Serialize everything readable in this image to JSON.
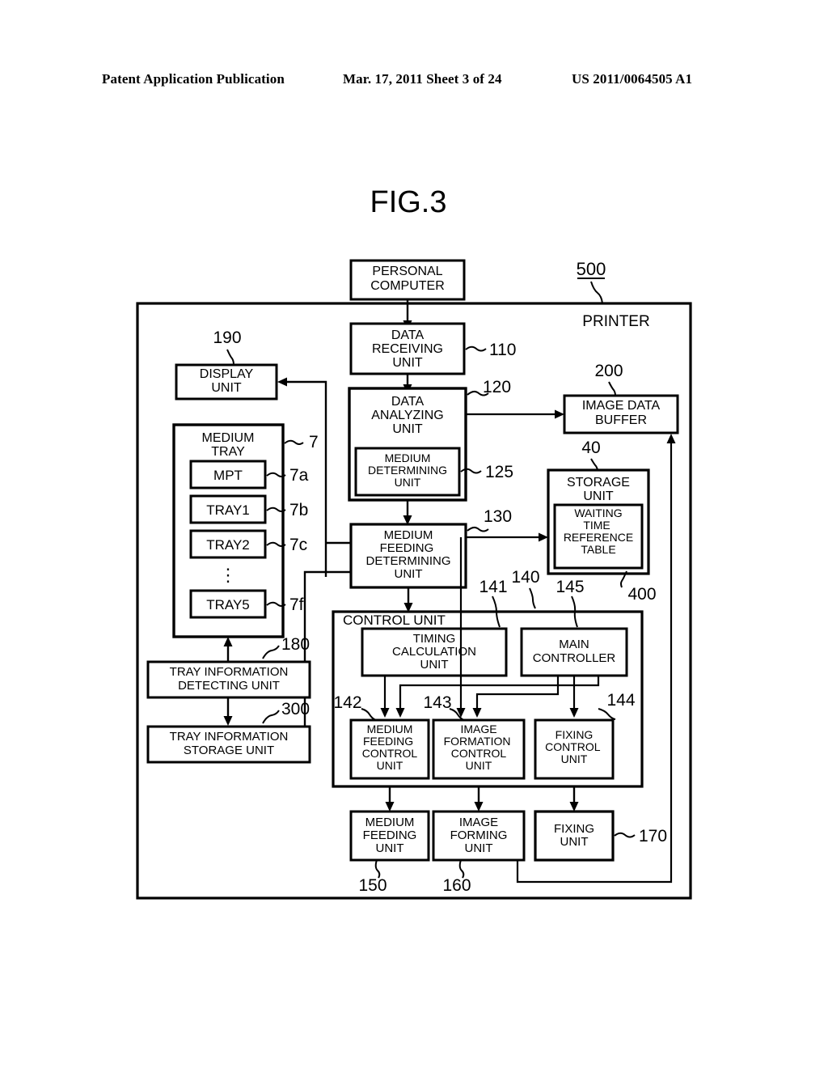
{
  "header": {
    "publication": "Patent Application Publication",
    "date_sheet": "Mar. 17, 2011  Sheet 3 of 24",
    "patent_number": "US 2011/0064505 A1"
  },
  "figure": {
    "title": "FIG.3",
    "enclosure_label": "PRINTER",
    "enclosure_ref": "500",
    "control_unit_label": "CONTROL  UNIT"
  },
  "blocks": {
    "personal_computer": {
      "label": "PERSONAL\nCOMPUTER",
      "ref": ""
    },
    "data_receiving": {
      "label": "DATA\nRECEIVING\nUNIT",
      "ref": "110"
    },
    "data_analyzing": {
      "label": "DATA\nANALYZING\nUNIT",
      "ref": "120"
    },
    "medium_determining": {
      "label": "MEDIUM\nDETERMINING\nUNIT",
      "ref": "125"
    },
    "medium_feeding_determining": {
      "label": "MEDIUM\nFEEDING\nDETERMINING\nUNIT",
      "ref": "130"
    },
    "display_unit": {
      "label": "DISPLAY\nUNIT",
      "ref": "190"
    },
    "medium_tray": {
      "label": "MEDIUM\nTRAY",
      "ref": "7"
    },
    "image_data_buffer": {
      "label": "IMAGE  DATA\nBUFFER",
      "ref": "200"
    },
    "storage_unit": {
      "label": "STORAGE\nUNIT",
      "ref": "40"
    },
    "waiting_time_reference_table": {
      "label": "WAITING\nTIME\nREFERENCE\nTABLE",
      "ref": "400"
    },
    "tray_information_detecting": {
      "label": "TRAY INFORMATION\nDETECTING  UNIT",
      "ref": "180"
    },
    "tray_information_storage": {
      "label": "TRAY  INFORMATION\nSTORAGE  UNIT",
      "ref": "300"
    },
    "control_unit": {
      "label": "CONTROL  UNIT",
      "ref": "140"
    },
    "timing_calculation": {
      "label": "TIMING\nCALCULATION\nUNIT",
      "ref": "141"
    },
    "main_controller": {
      "label": "MAIN\nCONTROLLER",
      "ref": "145"
    },
    "medium_feeding_control": {
      "label": "MEDIUM\nFEEDING\nCONTROL\nUNIT",
      "ref": "142"
    },
    "image_formation_control": {
      "label": "IMAGE\nFORMATION\nCONTROL\nUNIT",
      "ref": "143"
    },
    "fixing_control": {
      "label": "FIXING\nCONTROL\nUNIT",
      "ref": "144"
    },
    "medium_feeding_unit": {
      "label": "MEDIUM\nFEEDING\nUNIT",
      "ref": "150"
    },
    "image_forming_unit": {
      "label": "IMAGE\nFORMING\nUNIT",
      "ref": "160"
    },
    "fixing_unit": {
      "label": "FIXING\nUNIT",
      "ref": "170"
    }
  },
  "trays": [
    {
      "label": "MPT",
      "ref": "7a"
    },
    {
      "label": "TRAY1",
      "ref": "7b"
    },
    {
      "label": "TRAY2",
      "ref": "7c"
    },
    {
      "label": "TRAY5",
      "ref": "7f"
    }
  ],
  "tray_ellipsis": "⋮"
}
